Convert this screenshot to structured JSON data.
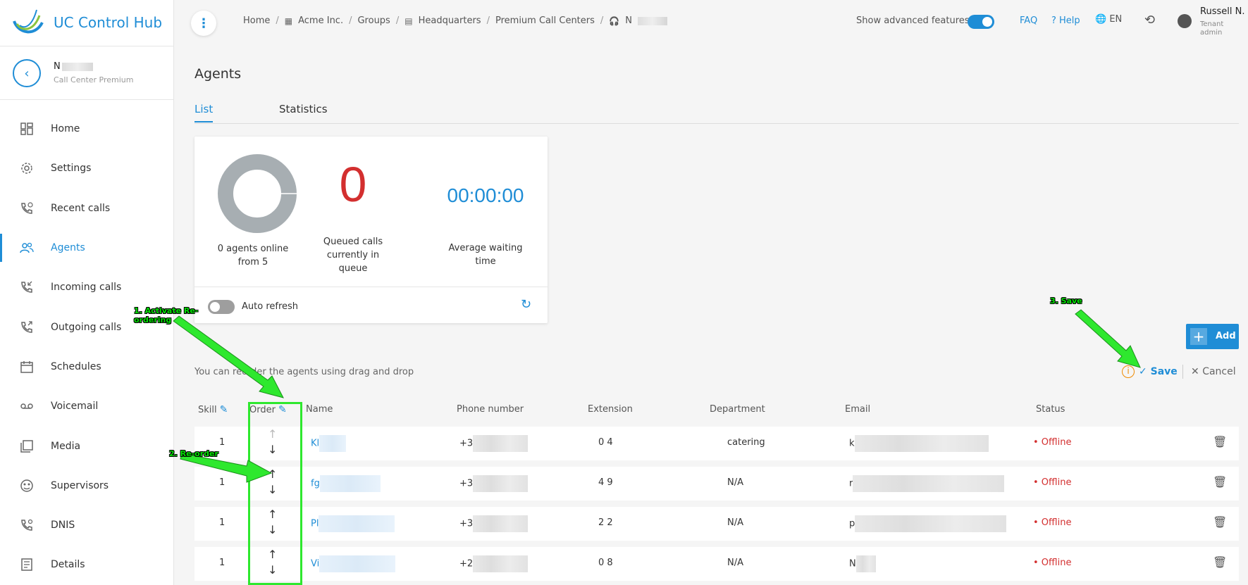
{
  "app": {
    "name": "UC Control Hub"
  },
  "context": {
    "name": "N",
    "subtitle": "Call Center Premium"
  },
  "nav": [
    {
      "label": "Home",
      "icon": "dashboard-icon"
    },
    {
      "label": "Settings",
      "icon": "gear-icon"
    },
    {
      "label": "Recent calls",
      "icon": "phone-clock-icon"
    },
    {
      "label": "Agents",
      "icon": "users-icon"
    },
    {
      "label": "Incoming calls",
      "icon": "phone-incoming-icon"
    },
    {
      "label": "Outgoing calls",
      "icon": "phone-outgoing-icon"
    },
    {
      "label": "Schedules",
      "icon": "calendar-icon"
    },
    {
      "label": "Voicemail",
      "icon": "voicemail-icon"
    },
    {
      "label": "Media",
      "icon": "media-icon"
    },
    {
      "label": "Supervisors",
      "icon": "supervisor-icon"
    },
    {
      "label": "DNIS",
      "icon": "phone-settings-icon"
    },
    {
      "label": "Details",
      "icon": "details-icon"
    }
  ],
  "breadcrumb": {
    "home": "Home",
    "org": "Acme Inc.",
    "groups": "Groups",
    "hq": "Headquarters",
    "premium": "Premium Call Centers",
    "current": "N"
  },
  "header": {
    "advanced": "Show advanced features",
    "faq": "FAQ",
    "help": "? Help",
    "lang": "EN",
    "user_name": "Russell N.",
    "user_role": "Tenant admin"
  },
  "page": {
    "title": "Agents"
  },
  "tabs": {
    "list": "List",
    "statistics": "Statistics"
  },
  "stats": {
    "agents_online": "0 agents online from 5",
    "queued_value": "0",
    "queued_label": "Queued calls currently in queue",
    "avg_value": "00:00:00",
    "avg_label": "Average waiting time",
    "auto_refresh": "Auto refresh"
  },
  "actions": {
    "add": "Add",
    "save": "Save",
    "cancel": "Cancel"
  },
  "hint": "You can reorder the agents using drag and drop",
  "table": {
    "headers": {
      "skill": "Skill",
      "order": "Order",
      "name": "Name",
      "phone": "Phone number",
      "extension": "Extension",
      "department": "Department",
      "email": "Email",
      "status": "Status"
    },
    "rows": [
      {
        "skill": "1",
        "name": "Kl",
        "phone": "+3",
        "extension": "0 4",
        "department": "catering",
        "email": "k",
        "status": "• Offline"
      },
      {
        "skill": "1",
        "name": "fg",
        "phone": "+3",
        "extension": "4 9",
        "department": "N/A",
        "email": "r",
        "status": "• Offline"
      },
      {
        "skill": "1",
        "name": "Pl",
        "phone": "+3",
        "extension": "2 2",
        "department": "N/A",
        "email": "p",
        "status": "• Offline"
      },
      {
        "skill": "1",
        "name": "Vi",
        "phone": "+2",
        "extension": "0 8",
        "department": "N/A",
        "email": "N",
        "status": "• Offline"
      }
    ]
  },
  "annotations": {
    "a1": "1. Activate Re-ordering",
    "a2": "2. Re-order",
    "a3": "3. Save"
  },
  "colors": {
    "accent": "#1f8dd6",
    "offline": "#d32f2f",
    "annotation": "#2ee82e"
  }
}
